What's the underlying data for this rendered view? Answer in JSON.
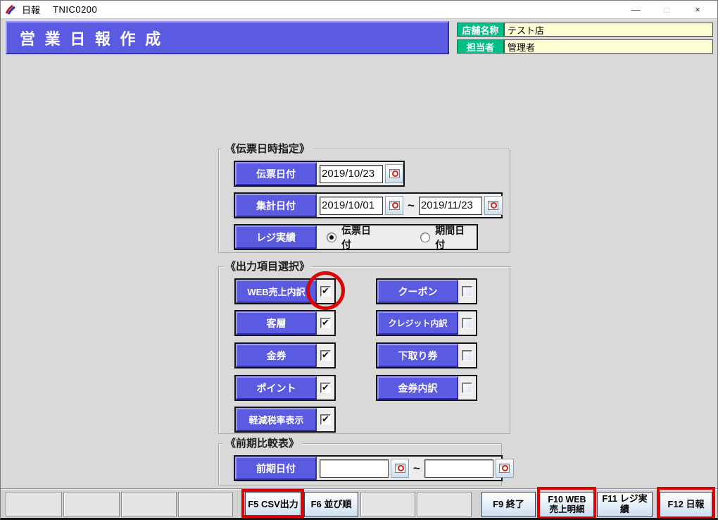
{
  "window": {
    "title": "日報",
    "code": "TNIC0200",
    "minimize_icon": "—",
    "maximize_icon": "□",
    "close_icon": "×"
  },
  "header": {
    "title": "営業日報作成",
    "store": {
      "label": "店舗名称",
      "value": "テスト店"
    },
    "manager": {
      "label": "担当者",
      "value": "管理者"
    }
  },
  "slip_section": {
    "title": "《伝票日時指定》",
    "slip_date": {
      "label": "伝票日付",
      "value": "2019/10/23"
    },
    "total_date": {
      "label": "集計日付",
      "from": "2019/10/01",
      "separator": "~",
      "to": "2019/11/23"
    },
    "register": {
      "label": "レジ実績",
      "options": [
        {
          "label": "伝票日付",
          "selected": true
        },
        {
          "label": "期間日付",
          "selected": false
        }
      ]
    }
  },
  "output_section": {
    "title": "《出力項目選択》",
    "left_items": [
      {
        "label": "WEB売上内訳",
        "checked": true
      },
      {
        "label": "客層",
        "checked": true
      },
      {
        "label": "金券",
        "checked": true
      },
      {
        "label": "ポイント",
        "checked": true
      },
      {
        "label": "軽減税率表示",
        "checked": true
      }
    ],
    "right_items": [
      {
        "label": "クーポン",
        "checked": false
      },
      {
        "label": "クレジット内訳",
        "checked": false
      },
      {
        "label": "下取り券",
        "checked": false
      },
      {
        "label": "金券内訳",
        "checked": false
      }
    ]
  },
  "compare_section": {
    "title": "《前期比較表》",
    "prev_date": {
      "label": "前期日付",
      "from": "",
      "separator": "~",
      "to": ""
    }
  },
  "function_bar": {
    "keys": [
      {
        "label": "",
        "highlighted": false
      },
      {
        "label": "",
        "highlighted": false
      },
      {
        "label": "",
        "highlighted": false
      },
      {
        "label": "",
        "highlighted": false
      },
      {
        "label": "F5 CSV出力",
        "highlighted": true
      },
      {
        "label": "F6 並び順",
        "highlighted": false
      },
      {
        "label": "",
        "highlighted": false
      },
      {
        "label": "",
        "highlighted": false
      },
      {
        "label": "F9 終了",
        "highlighted": false
      },
      {
        "label": "F10 WEB\n売上明細",
        "highlighted": true
      },
      {
        "label": "F11 レジ実績",
        "highlighted": false
      },
      {
        "label": "F12 日報",
        "highlighted": true
      }
    ]
  },
  "colors": {
    "accent_blue": "#5b5be2",
    "accent_green": "#00be86",
    "field_yellow": "#ffffd6",
    "annotation_red": "#dd0000"
  }
}
